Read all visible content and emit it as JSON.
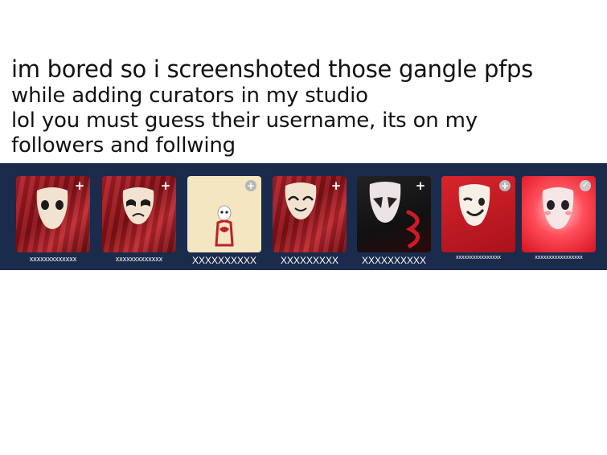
{
  "caption": {
    "line1": "im bored so i screenshoted those gangle pfps",
    "line2": "while adding curators in my studio",
    "line3": "lol you must guess their username, its on my",
    "line4": "followers and follwing"
  },
  "curators": [
    {
      "username": "xxxxxxxxxxxxx",
      "action_icon": "plus-icon"
    },
    {
      "username": "xxxxxxxxxxxxx",
      "action_icon": "plus-icon"
    },
    {
      "username": "XXXXXXXXXX",
      "action_icon": "plus-circle-icon"
    },
    {
      "username": "XXXXXXXXX",
      "action_icon": "plus-icon"
    },
    {
      "username": "XXXXXXXXXX",
      "action_icon": "plus-icon"
    },
    {
      "username": "xxxxxxxxxxxxxxxx",
      "action_icon": "plus-circle-icon"
    },
    {
      "username": "xxxxxxxxxxxxxxxxx",
      "action_icon": "check-circle-icon"
    }
  ],
  "colors": {
    "strip_background": "#1a2b4c",
    "username_text": "#ffffff"
  }
}
